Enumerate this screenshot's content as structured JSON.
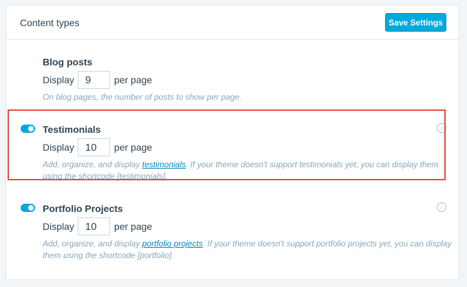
{
  "header": {
    "title": "Content types",
    "save_label": "Save Settings"
  },
  "blog": {
    "title": "Blog posts",
    "display_label": "Display",
    "value": "9",
    "suffix": "per page",
    "description": "On blog pages, the number of posts to show per page."
  },
  "testimonials": {
    "toggle_on": true,
    "title": "Testimonials",
    "display_label": "Display",
    "value": "10",
    "suffix": "per page",
    "desc_before": "Add, organize, and display ",
    "desc_link": "testimonials",
    "desc_after": ". If your theme doesn't support testimonials yet, you can display them using the shortcode [testimonials]."
  },
  "portfolio": {
    "toggle_on": true,
    "title": "Portfolio Projects",
    "display_label": "Display",
    "value": "10",
    "suffix": "per page",
    "desc_before": "Add, organize, and display ",
    "desc_link": "portfolio projects",
    "desc_after": ". If your theme doesn't support portfolio projects yet, you can display them using the shortcode [portfolio]."
  },
  "colors": {
    "accent": "#00aadc",
    "link": "#0087be",
    "highlight": "#e14d3c"
  }
}
